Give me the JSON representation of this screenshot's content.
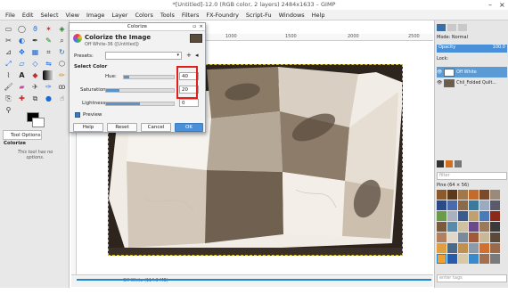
{
  "window": {
    "title": "*[Untitled]-12.0 (RGB color, 2 layers) 2484x1633 – GIMP"
  },
  "menubar": [
    "File",
    "Edit",
    "Select",
    "View",
    "Image",
    "Layer",
    "Colors",
    "Tools",
    "Filters",
    "FX-Foundry",
    "Script-Fu",
    "Windows",
    "Help"
  ],
  "tool_options": {
    "tab": "Tool Options",
    "heading": "Colorize",
    "note": "This tool has no options."
  },
  "ruler": {
    "marks": [
      "1000",
      "1500",
      "2000",
      "2500"
    ]
  },
  "status": {
    "text": "Off White (114.3 MB)"
  },
  "colorize_dialog": {
    "window_title": "Colorize",
    "heading": "Colorize the Image",
    "subheading": "Off White-36 ([Untitled])",
    "presets_label": "Presets:",
    "section": "Select Color",
    "hue": {
      "label": "Hue:",
      "value": "40",
      "fraction": 0.11
    },
    "saturation": {
      "label": "Saturation:",
      "value": "20",
      "fraction": 0.2
    },
    "lightness": {
      "label": "Lightness:",
      "value": "0",
      "fraction": 0.5
    },
    "preview_label": "Preview",
    "buttons": {
      "help": "Help",
      "reset": "Reset",
      "cancel": "Cancel",
      "ok": "OK"
    }
  },
  "layers_panel": {
    "mode_label": "Mode:",
    "mode_value": "Normal",
    "opacity_label": "Opacity",
    "opacity_value": "100.0",
    "lock_label": "Lock:",
    "layers": [
      "Off White",
      "Chil_Folded Quilt..."
    ]
  },
  "patterns_panel": {
    "filter_placeholder": "filter",
    "pattern_name": "Pine (64 × 56)",
    "tags_placeholder": "enter tags"
  },
  "colors": {
    "accent": "#1d87d6",
    "highlight": "#e0201b",
    "selected_layer": "#5b9bd5"
  }
}
